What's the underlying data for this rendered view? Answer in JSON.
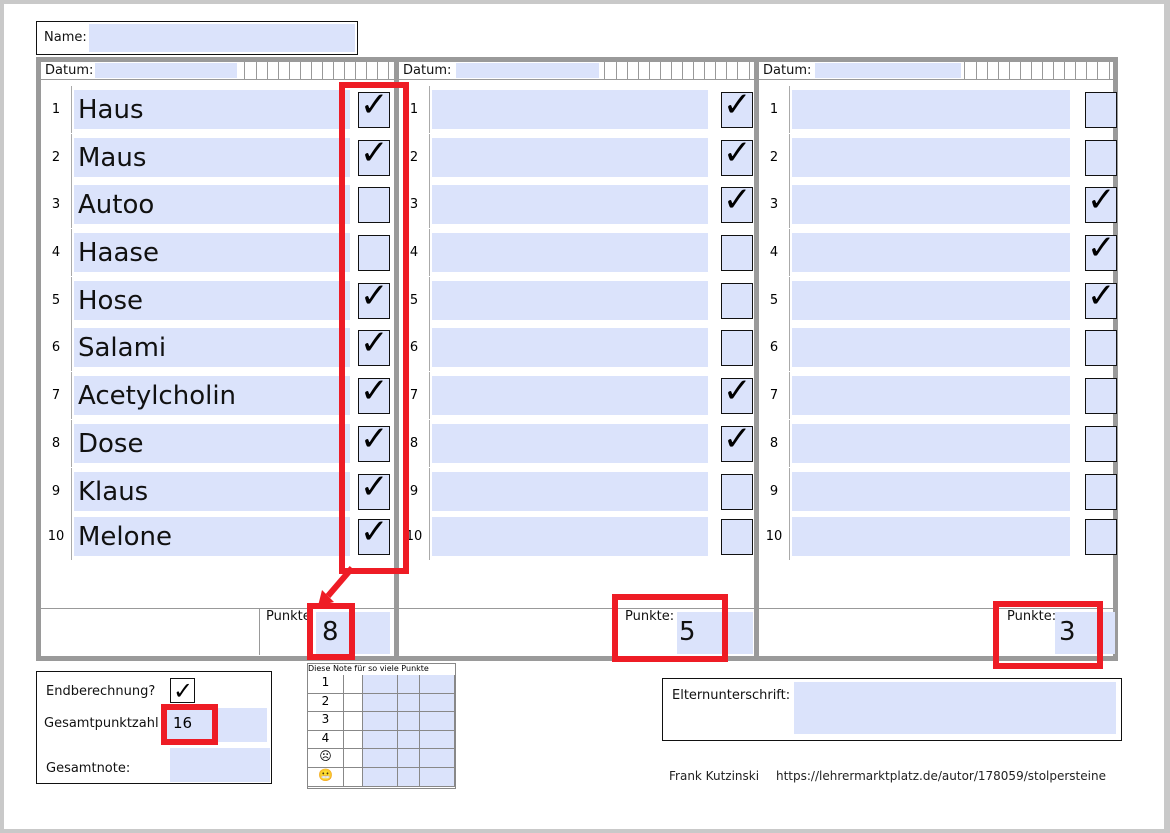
{
  "name_label": "Name:",
  "datum_label": "Datum:",
  "punkte_label": "Punkte",
  "punkte_label_colon": "Punkte:",
  "row_numbers": [
    "1",
    "2",
    "3",
    "4",
    "5",
    "6",
    "7",
    "8",
    "9",
    "10"
  ],
  "words": [
    "Haus",
    "Maus",
    "Autoo",
    "Haase",
    "Hose",
    "Salami",
    "Acetylcholin",
    "Dose",
    "Klaus",
    "Melone"
  ],
  "check_glyph": "✓",
  "columns": [
    {
      "checked": [
        true,
        true,
        false,
        false,
        true,
        true,
        true,
        true,
        true,
        true
      ],
      "score": "8"
    },
    {
      "checked": [
        true,
        true,
        true,
        false,
        false,
        false,
        true,
        true,
        false,
        false
      ],
      "score": "5"
    },
    {
      "checked": [
        false,
        false,
        true,
        true,
        true,
        false,
        false,
        false,
        false,
        false
      ],
      "score": "3"
    }
  ],
  "endberechnung_label": "Endberechnung?",
  "endberechnung_checked": true,
  "gesamtpunktzahl_label": "Gesamtpunktzahl",
  "gesamtpunktzahl_value": "16",
  "gesamtnote_label": "Gesamtnote:",
  "grade_table": {
    "header": "Diese Note für so viele Punkte",
    "grades": [
      "1",
      "2",
      "3",
      "4",
      "☹",
      "😬"
    ]
  },
  "elternunterschrift_label": "Elternunterschrift:",
  "author": "Frank Kutzinski",
  "url": "https://lehrermarktplatz.de/autor/178059/stolpersteine",
  "colors": {
    "fill": "#dbe3fb",
    "highlight": "#ee1c25",
    "border": "#9a9a9a"
  }
}
